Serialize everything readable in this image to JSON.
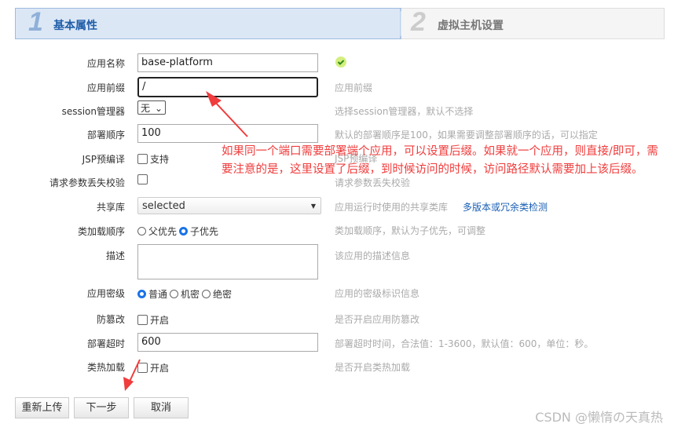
{
  "steps": [
    {
      "num": "1",
      "label": "基本属性",
      "active": true
    },
    {
      "num": "2",
      "label": "虚拟主机设置",
      "active": false
    }
  ],
  "form": {
    "app_name": {
      "label": "应用名称",
      "value": "base-platform",
      "status": "valid-check-icon"
    },
    "prefix": {
      "label": "应用前缀",
      "value": "/",
      "hint": "应用前缀"
    },
    "session": {
      "label": "session管理器",
      "value": "无",
      "hint": "选择session管理器，默认不选择"
    },
    "order": {
      "label": "部署顺序",
      "value": "100",
      "hint": "默认的部署顺序是100，如果需要调整部署顺序的话，可以指定"
    },
    "jsp": {
      "label": "JSP预编译",
      "option": "支持",
      "checked": false,
      "hint": "JSP预编译"
    },
    "param_check": {
      "label": "请求参数丢失校验",
      "checked": false,
      "hint": "请求参数丢失校验"
    },
    "shared_lib": {
      "label": "共享库",
      "value": "selected",
      "hint": "应用运行时使用的共享类库",
      "link": "多版本或冗余类检测"
    },
    "classload": {
      "label": "类加载顺序",
      "options": [
        "父优先",
        "子优先"
      ],
      "selected": "子优先",
      "hint": "类加载顺序，默认为子优先，可调整"
    },
    "desc": {
      "label": "描述",
      "value": "",
      "hint": "该应用的描述信息"
    },
    "secret": {
      "label": "应用密级",
      "options": [
        "普通",
        "机密",
        "绝密"
      ],
      "selected": "普通",
      "hint": "应用的密级标识信息"
    },
    "tamper": {
      "label": "防篡改",
      "option": "开启",
      "checked": false,
      "hint": "是否开启应用防篡改"
    },
    "timeout": {
      "label": "部署超时",
      "value": "600",
      "hint": "部署超时时间，合法值：1-3600，默认值：600，单位：秒。"
    },
    "hotload": {
      "label": "类热加载",
      "option": "开启",
      "checked": false,
      "hint": "是否开启类热加载"
    }
  },
  "buttons": {
    "reupload": "重新上传",
    "next": "下一步",
    "cancel": "取消"
  },
  "annotation": "如果同一个端口需要部署端个应用，可以设置后缀。如果就一个应用，则直接/即可，需要注意的是，这里设置了后缀，到时候访问的时候，访问路径默认需要加上该后缀。",
  "watermark": "CSDN @懒惰の天真热",
  "colors": {
    "annotation": "#f03c3c",
    "link": "#1a5fb4",
    "active_step_bg": "#dce7f6"
  }
}
